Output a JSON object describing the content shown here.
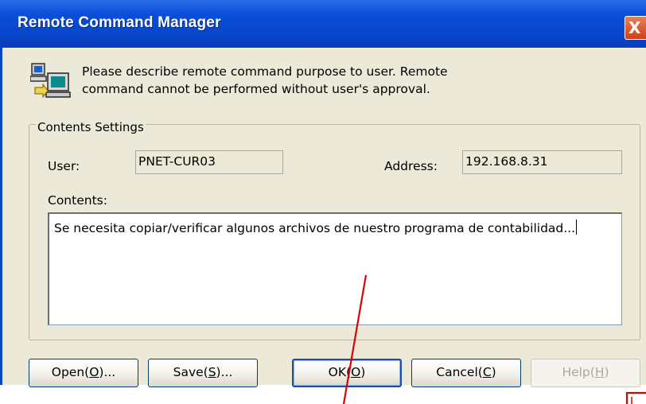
{
  "window": {
    "title": "Remote Command Manager",
    "close_glyph": "X"
  },
  "intro": {
    "icon": "computer-network-icon",
    "line1": "Please describe remote command purpose to user. Remote",
    "line2": "command cannot be performed without user's approval."
  },
  "contents_settings": {
    "group_label": "Contents Settings",
    "user_label": "User:",
    "user_value": "PNET-CUR03",
    "address_label": "Address:",
    "address_value": "192.168.8.31",
    "contents_label": "Contents:",
    "contents_value": "Se necesita copiar/verificar algunos archivos de nuestro programa de contabilidad..."
  },
  "buttons": {
    "open": "Open(O)...",
    "save": "Save(S)...",
    "ok": "OK(O)",
    "cancel": "Cancel(C)",
    "help": "Help(H)"
  },
  "colors": {
    "title_bar": "#0846cc",
    "dialog_face": "#ece9d8",
    "close_button": "#d4502a",
    "annotation_line": "#e00000"
  }
}
